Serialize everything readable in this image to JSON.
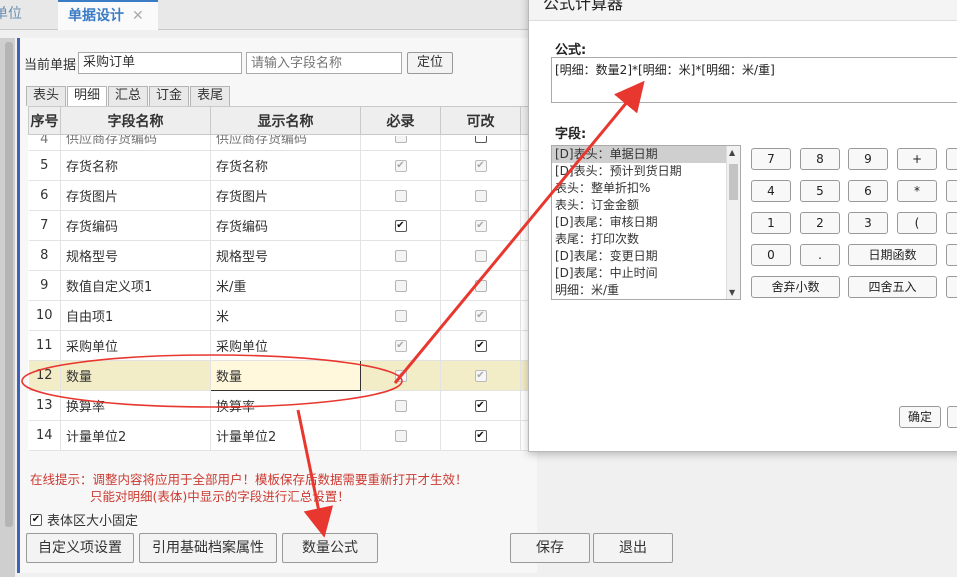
{
  "topbar": {
    "tab_unit": "单位",
    "tab_design": "单据设计",
    "close": "✕"
  },
  "form": {
    "current_label": "当前单据",
    "current_value": "采购订单",
    "field_search_placeholder": "请输入字段名称",
    "locate_btn": "定位"
  },
  "subtabs": [
    "表头",
    "明细",
    "汇总",
    "订金",
    "表尾"
  ],
  "grid": {
    "headers": [
      "序号",
      "字段名称",
      "显示名称",
      "必录",
      "可改"
    ],
    "partial_row": {
      "no": "4",
      "field": "供应商存货编码",
      "display": "供应商存货编码"
    },
    "rows": [
      {
        "no": "5",
        "field": "存货名称",
        "display": "存货名称",
        "req": true,
        "req_dis": true,
        "edit": true,
        "edit_dis": true
      },
      {
        "no": "6",
        "field": "存货图片",
        "display": "存货图片",
        "req": false,
        "req_dis": true,
        "edit": false,
        "edit_dis": true
      },
      {
        "no": "7",
        "field": "存货编码",
        "display": "存货编码",
        "req": true,
        "req_dis": false,
        "edit": true,
        "edit_dis": true
      },
      {
        "no": "8",
        "field": "规格型号",
        "display": "规格型号",
        "req": false,
        "req_dis": true,
        "edit": false,
        "edit_dis": true
      },
      {
        "no": "9",
        "field": "数值自定义项1",
        "display": "米/重",
        "req": false,
        "req_dis": false,
        "edit": false,
        "edit_dis": false
      },
      {
        "no": "10",
        "field": "自由项1",
        "display": "米",
        "req": false,
        "req_dis": true,
        "edit": true,
        "edit_dis": true
      },
      {
        "no": "11",
        "field": "采购单位",
        "display": "采购单位",
        "req": true,
        "req_dis": true,
        "edit": true,
        "edit_dis": false
      },
      {
        "no": "12",
        "field": "数量",
        "display": "数量",
        "req": true,
        "req_dis": true,
        "edit": true,
        "edit_dis": true,
        "selected": true
      },
      {
        "no": "13",
        "field": "换算率",
        "display": "换算率",
        "req": false,
        "req_dis": true,
        "edit": true,
        "edit_dis": false
      },
      {
        "no": "14",
        "field": "计量单位2",
        "display": "计量单位2",
        "req": false,
        "req_dis": true,
        "edit": true,
        "edit_dis": false
      }
    ]
  },
  "hint": {
    "line1": "在线提示：调整内容将应用于全部用户！模板保存后数据需要重新打开才生效！",
    "line2": "只能对明细(表体)中显示的字段进行汇总设置！"
  },
  "fixed_checkbox_label": "表体区大小固定",
  "buttons": {
    "custom": "自定义项设置",
    "reference": "引用基础档案属性",
    "qty_formula": "数量公式",
    "save": "保存",
    "exit": "退出"
  },
  "dialog": {
    "title": "公式计算器",
    "formula_label": "公式:",
    "formula_value": "[明细：数量2]*[明细：米]*[明细：米/重]",
    "fields_label": "字段:",
    "fields": [
      "[D]表头：单据日期",
      "[D]表头：预计到货日期",
      "表头：整单折扣%",
      "表头：订金金额",
      "[D]表尾：审核日期",
      "表尾：打印次数",
      "[D]表尾：变更日期",
      "[D]表尾：中止时间",
      "明细：米/重"
    ],
    "keys_row1": [
      "7",
      "8",
      "9",
      "+"
    ],
    "keys_row2": [
      "4",
      "5",
      "6",
      "*"
    ],
    "keys_row3": [
      "1",
      "2",
      "3",
      "("
    ],
    "key_0": "0",
    "key_dot": ".",
    "key_date": "日期函数",
    "key_trunc": "舍弃小数",
    "key_round": "四舍五入",
    "ok": "确定"
  },
  "colors": {
    "accent": "#3c7cc4",
    "warning": "#cc3b32",
    "arrow": "#e8372f",
    "selected_row": "#f2ecc7"
  }
}
